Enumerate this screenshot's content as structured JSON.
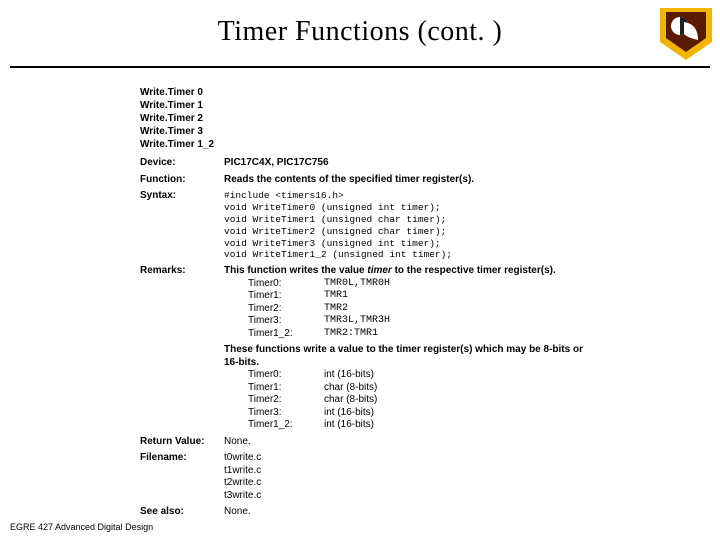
{
  "title": "Timer Functions (cont. )",
  "footer": "EGRE 427 Advanced Digital Design",
  "heads": [
    "Write.Timer 0",
    "Write.Timer 1",
    "Write.Timer 2",
    "Write.Timer 3",
    "Write.Timer 1_2"
  ],
  "labels": {
    "device": "Device:",
    "function": "Function:",
    "syntax": "Syntax:",
    "remarks": "Remarks:",
    "return": "Return Value:",
    "filename": "Filename:",
    "seealso": "See also:"
  },
  "device": "PIC17C4X, PIC17C756",
  "function": "Reads the contents of the specified timer register(s).",
  "syntax": [
    "#include <timers16.h>",
    "void WriteTimer0 (unsigned int timer);",
    "void WriteTimer1 (unsigned char timer);",
    "void WriteTimer2 (unsigned char timer);",
    "void WriteTimer3 (unsigned int timer);",
    "void WriteTimer1_2 (unsigned int timer);"
  ],
  "remarks_lead_a": "This function writes the value ",
  "remarks_lead_i": "timer",
  "remarks_lead_b": " to the respective timer register(s).",
  "regmap": [
    {
      "t": "Timer0:",
      "r": "TMR0L,TMR0H"
    },
    {
      "t": "Timer1:",
      "r": "TMR1"
    },
    {
      "t": "Timer2:",
      "r": "TMR2"
    },
    {
      "t": "Timer3:",
      "r": "TMR3L,TMR3H"
    },
    {
      "t": "Timer1_2:",
      "r": "TMR2:TMR1"
    }
  ],
  "remarks_lead2": "These functions write a value to the timer register(s) which may be 8-bits or 16-bits.",
  "bitmap": [
    {
      "t": "Timer0:",
      "r": "int (16-bits)"
    },
    {
      "t": "Timer1:",
      "r": "char (8-bits)"
    },
    {
      "t": "Timer2:",
      "r": "char (8-bits)"
    },
    {
      "t": "Timer3:",
      "r": "int (16-bits)"
    },
    {
      "t": "Timer1_2:",
      "r": "int (16-bits)"
    }
  ],
  "return": "None.",
  "filenames": [
    "t0write.c",
    "t1write.c",
    "t2write.c",
    "t3write.c"
  ],
  "seealso": "None."
}
